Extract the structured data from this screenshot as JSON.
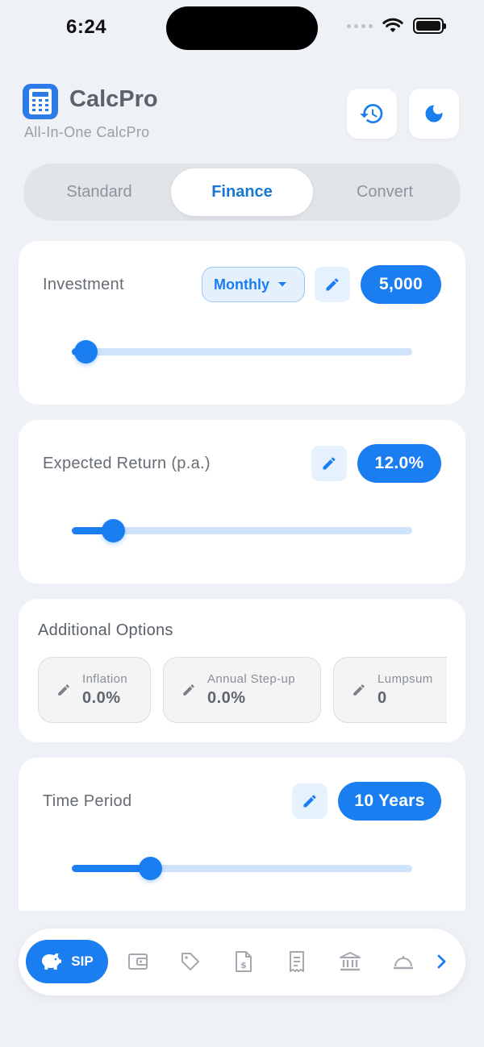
{
  "status_bar": {
    "time": "6:24"
  },
  "header": {
    "title": "CalcPro",
    "subtitle": "All-In-One CalcPro"
  },
  "tabs": [
    {
      "label": "Standard",
      "active": false
    },
    {
      "label": "Finance",
      "active": true
    },
    {
      "label": "Convert",
      "active": false
    }
  ],
  "investment": {
    "label": "Investment",
    "frequency": "Monthly",
    "value": "5,000",
    "slider_fraction": 0.04
  },
  "expected_return": {
    "label": "Expected Return (p.a.)",
    "value": "12.0%",
    "slider_fraction": 0.12
  },
  "additional_options": {
    "title": "Additional Options",
    "items": [
      {
        "label": "Inflation",
        "value": "0.0%"
      },
      {
        "label": "Annual Step-up",
        "value": "0.0%"
      },
      {
        "label": "Lumpsum",
        "value": "0"
      }
    ]
  },
  "time_period": {
    "label": "Time Period",
    "value": "10 Years",
    "slider_fraction": 0.23
  },
  "bottom_nav": {
    "active_label": "SIP",
    "items": [
      "piggy-bank-icon",
      "wallet-icon",
      "tag-icon",
      "dollar-doc-icon",
      "receipt-icon",
      "bank-icon",
      "cloche-icon",
      "chevron-right-icon"
    ]
  },
  "colors": {
    "accent": "#1a7ef1",
    "background": "#eef1f5",
    "card": "#ffffff"
  }
}
